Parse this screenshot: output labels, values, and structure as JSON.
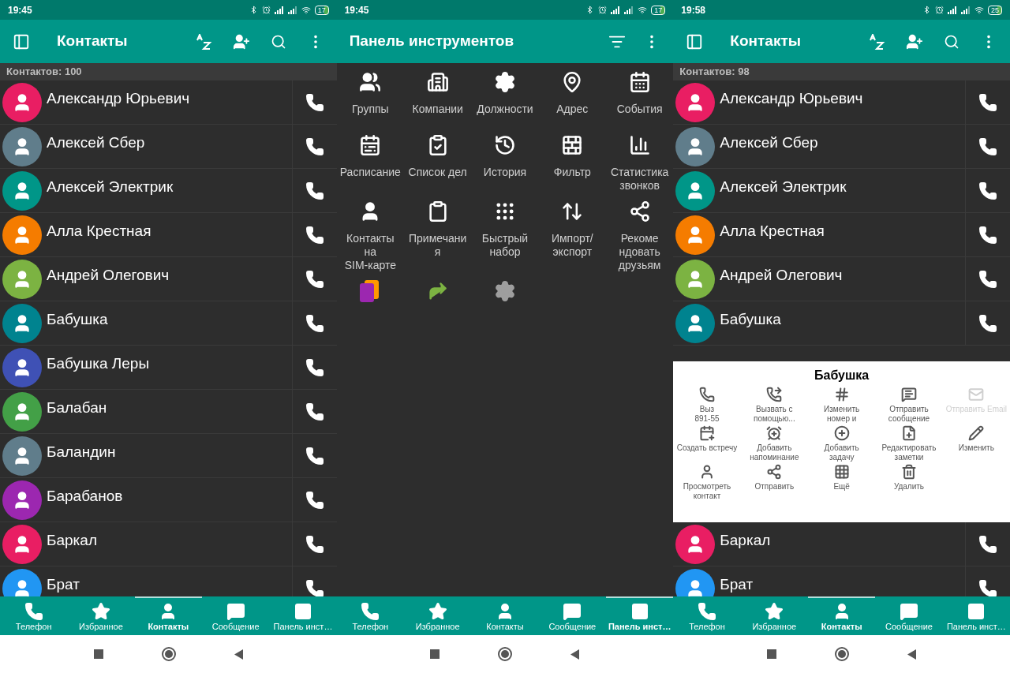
{
  "panels": [
    {
      "kind": "contacts",
      "status": {
        "time": "19:45",
        "battery": "17"
      },
      "toolbar": {
        "title": "Контакты"
      },
      "count": "Контактов: 100",
      "contacts": [
        {
          "name": "Александр Юрьевич",
          "color": "#e91e63"
        },
        {
          "name": "Алексей Сбер",
          "color": "#607d8b"
        },
        {
          "name": "Алексей Электрик",
          "color": "#009688"
        },
        {
          "name": "Алла Крестная",
          "color": "#f57c00"
        },
        {
          "name": "Андрей Олегович",
          "color": "#7cb342"
        },
        {
          "name": "Бабушка",
          "color": "#00838f"
        },
        {
          "name": "Бабушка Леры",
          "color": "#3f51b5"
        },
        {
          "name": "Балабан",
          "color": "#43a047"
        },
        {
          "name": "Баландин",
          "color": "#607d8b"
        },
        {
          "name": "Барабанов",
          "color": "#9c27b0"
        },
        {
          "name": "Баркал",
          "color": "#e91e63"
        },
        {
          "name": "Брат",
          "color": "#2196f3"
        }
      ],
      "tabs": [
        {
          "label": "Телефон",
          "selected": false
        },
        {
          "label": "Избранное",
          "selected": false
        },
        {
          "label": "Контакты",
          "selected": true
        },
        {
          "label": "Сообщение",
          "selected": false
        },
        {
          "label": "Панель инст…",
          "selected": false
        }
      ]
    },
    {
      "kind": "tools",
      "status": {
        "time": "19:45",
        "battery": "17"
      },
      "toolbar": {
        "title": "Панель инструментов"
      },
      "tools": [
        {
          "kind": "labeled",
          "label": "Группы"
        },
        {
          "kind": "labeled",
          "label": "Компании"
        },
        {
          "kind": "labeled",
          "label": "Должности"
        },
        {
          "kind": "labeled",
          "label": "Адрес"
        },
        {
          "kind": "labeled",
          "label": "События"
        },
        {
          "kind": "labeled",
          "label": "Расписание"
        },
        {
          "kind": "labeled",
          "label": "Список дел"
        },
        {
          "kind": "labeled",
          "label": "История"
        },
        {
          "kind": "labeled",
          "label": "Фильтр"
        },
        {
          "kind": "labeled",
          "label": "Статистика\nзвонков"
        },
        {
          "kind": "labeled",
          "label": "Контакты\nна\nSIM-карте"
        },
        {
          "kind": "labeled",
          "label": "Примечани\nя"
        },
        {
          "kind": "labeled",
          "label": "Быстрый\nнабор"
        },
        {
          "kind": "labeled",
          "label": "Импорт/\nэкспорт"
        },
        {
          "kind": "labeled",
          "label": "Рекоме\nндовать\nдрузьям"
        },
        {
          "kind": "icon"
        },
        {
          "kind": "icon"
        },
        {
          "kind": "icon"
        }
      ],
      "tabs": [
        {
          "label": "Телефон",
          "selected": false
        },
        {
          "label": "Избранное",
          "selected": false
        },
        {
          "label": "Контакты",
          "selected": false
        },
        {
          "label": "Сообщение",
          "selected": false
        },
        {
          "label": "Панель инст…",
          "selected": true
        }
      ]
    },
    {
      "kind": "contacts",
      "status": {
        "time": "19:58",
        "battery": "25"
      },
      "toolbar": {
        "title": "Контакты"
      },
      "count": "Контактов: 98",
      "contacts": [
        {
          "name": "Александр Юрьевич",
          "color": "#e91e63"
        },
        {
          "name": "Алексей Сбер",
          "color": "#607d8b"
        },
        {
          "name": "Алексей Электрик",
          "color": "#009688"
        },
        {
          "name": "Алла Крестная",
          "color": "#f57c00"
        },
        {
          "name": "Андрей Олегович",
          "color": "#7cb342"
        },
        {
          "name": "Бабушка",
          "color": "#00838f"
        }
      ],
      "contacts_below": [
        {
          "name": "Баркал",
          "color": "#e91e63"
        },
        {
          "name": "Брат",
          "color": "#2196f3"
        }
      ],
      "dialog": {
        "title": "Бабушка",
        "actions": [
          {
            "label": "Выз\n891-55",
            "disabled": false
          },
          {
            "label": "Вызвать с\nпомощью...",
            "disabled": false
          },
          {
            "label": "Изменить\nномер и",
            "disabled": false
          },
          {
            "label": "Отправить\nсообщение",
            "disabled": false
          },
          {
            "label": "Отправить Email",
            "disabled": true
          },
          {
            "label": "Создать встречу",
            "disabled": false
          },
          {
            "label": "Добавить\nнапоминание",
            "disabled": false
          },
          {
            "label": "Добавить\nзадачу",
            "disabled": false
          },
          {
            "label": "Редактировать\nзаметки",
            "disabled": false
          },
          {
            "label": "Изменить",
            "disabled": false
          },
          {
            "label": "Просмотреть\nконтакт",
            "disabled": false
          },
          {
            "label": "Отправить",
            "disabled": false
          },
          {
            "label": "Ещё",
            "disabled": false
          },
          {
            "label": "Удалить",
            "disabled": false
          }
        ]
      },
      "tabs": [
        {
          "label": "Телефон",
          "selected": false
        },
        {
          "label": "Избранное",
          "selected": false
        },
        {
          "label": "Контакты",
          "selected": true
        },
        {
          "label": "Сообщение",
          "selected": false
        },
        {
          "label": "Панель инст…",
          "selected": false
        }
      ]
    }
  ]
}
